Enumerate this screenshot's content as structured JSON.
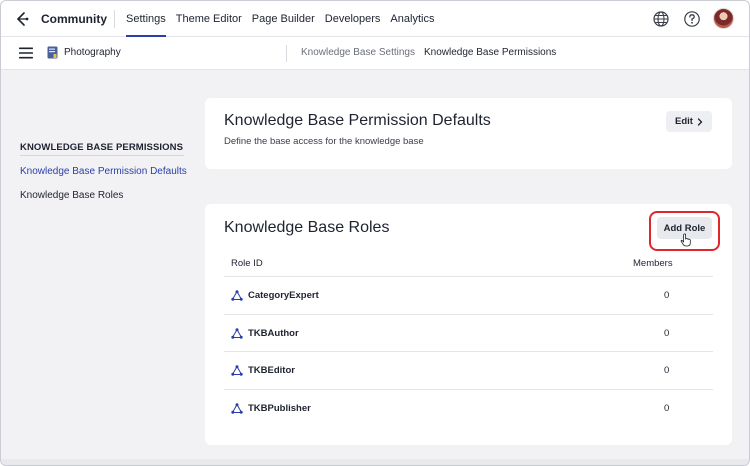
{
  "topnav": {
    "brand": "Community",
    "tabs": [
      {
        "label": "Settings",
        "active": true
      },
      {
        "label": "Theme Editor",
        "active": false
      },
      {
        "label": "Page Builder",
        "active": false
      },
      {
        "label": "Developers",
        "active": false
      },
      {
        "label": "Analytics",
        "active": false
      }
    ]
  },
  "subbar": {
    "site_name": "Photography",
    "breadcrumb": [
      "Knowledge Base Settings",
      "Knowledge Base Permissions"
    ]
  },
  "sidebar": {
    "heading": "KNOWLEDGE BASE PERMISSIONS",
    "items": [
      {
        "label": "Knowledge Base Permission Defaults",
        "active": true
      },
      {
        "label": "Knowledge Base Roles",
        "active": false
      }
    ]
  },
  "defaults_card": {
    "title": "Knowledge Base Permission Defaults",
    "subtitle": "Define the base access for the knowledge base",
    "edit_label": "Edit"
  },
  "roles_card": {
    "title": "Knowledge Base Roles",
    "add_role_label": "Add Role",
    "columns": [
      "Role ID",
      "Members"
    ],
    "rows": [
      {
        "role": "CategoryExpert",
        "members": "0"
      },
      {
        "role": "TKBAuthor",
        "members": "0"
      },
      {
        "role": "TKBEditor",
        "members": "0"
      },
      {
        "role": "TKBPublisher",
        "members": "0"
      }
    ]
  },
  "colors": {
    "accent": "#2b3ea8",
    "highlight": "#e0262c",
    "background": "#f2f2f4"
  },
  "icons": {
    "logo": "community-logo-icon",
    "globe": "globe-icon",
    "help": "help-icon",
    "menu": "hamburger-menu-icon",
    "site": "site-book-icon",
    "role": "role-nodes-icon",
    "cursor": "pointer-hand-icon"
  }
}
